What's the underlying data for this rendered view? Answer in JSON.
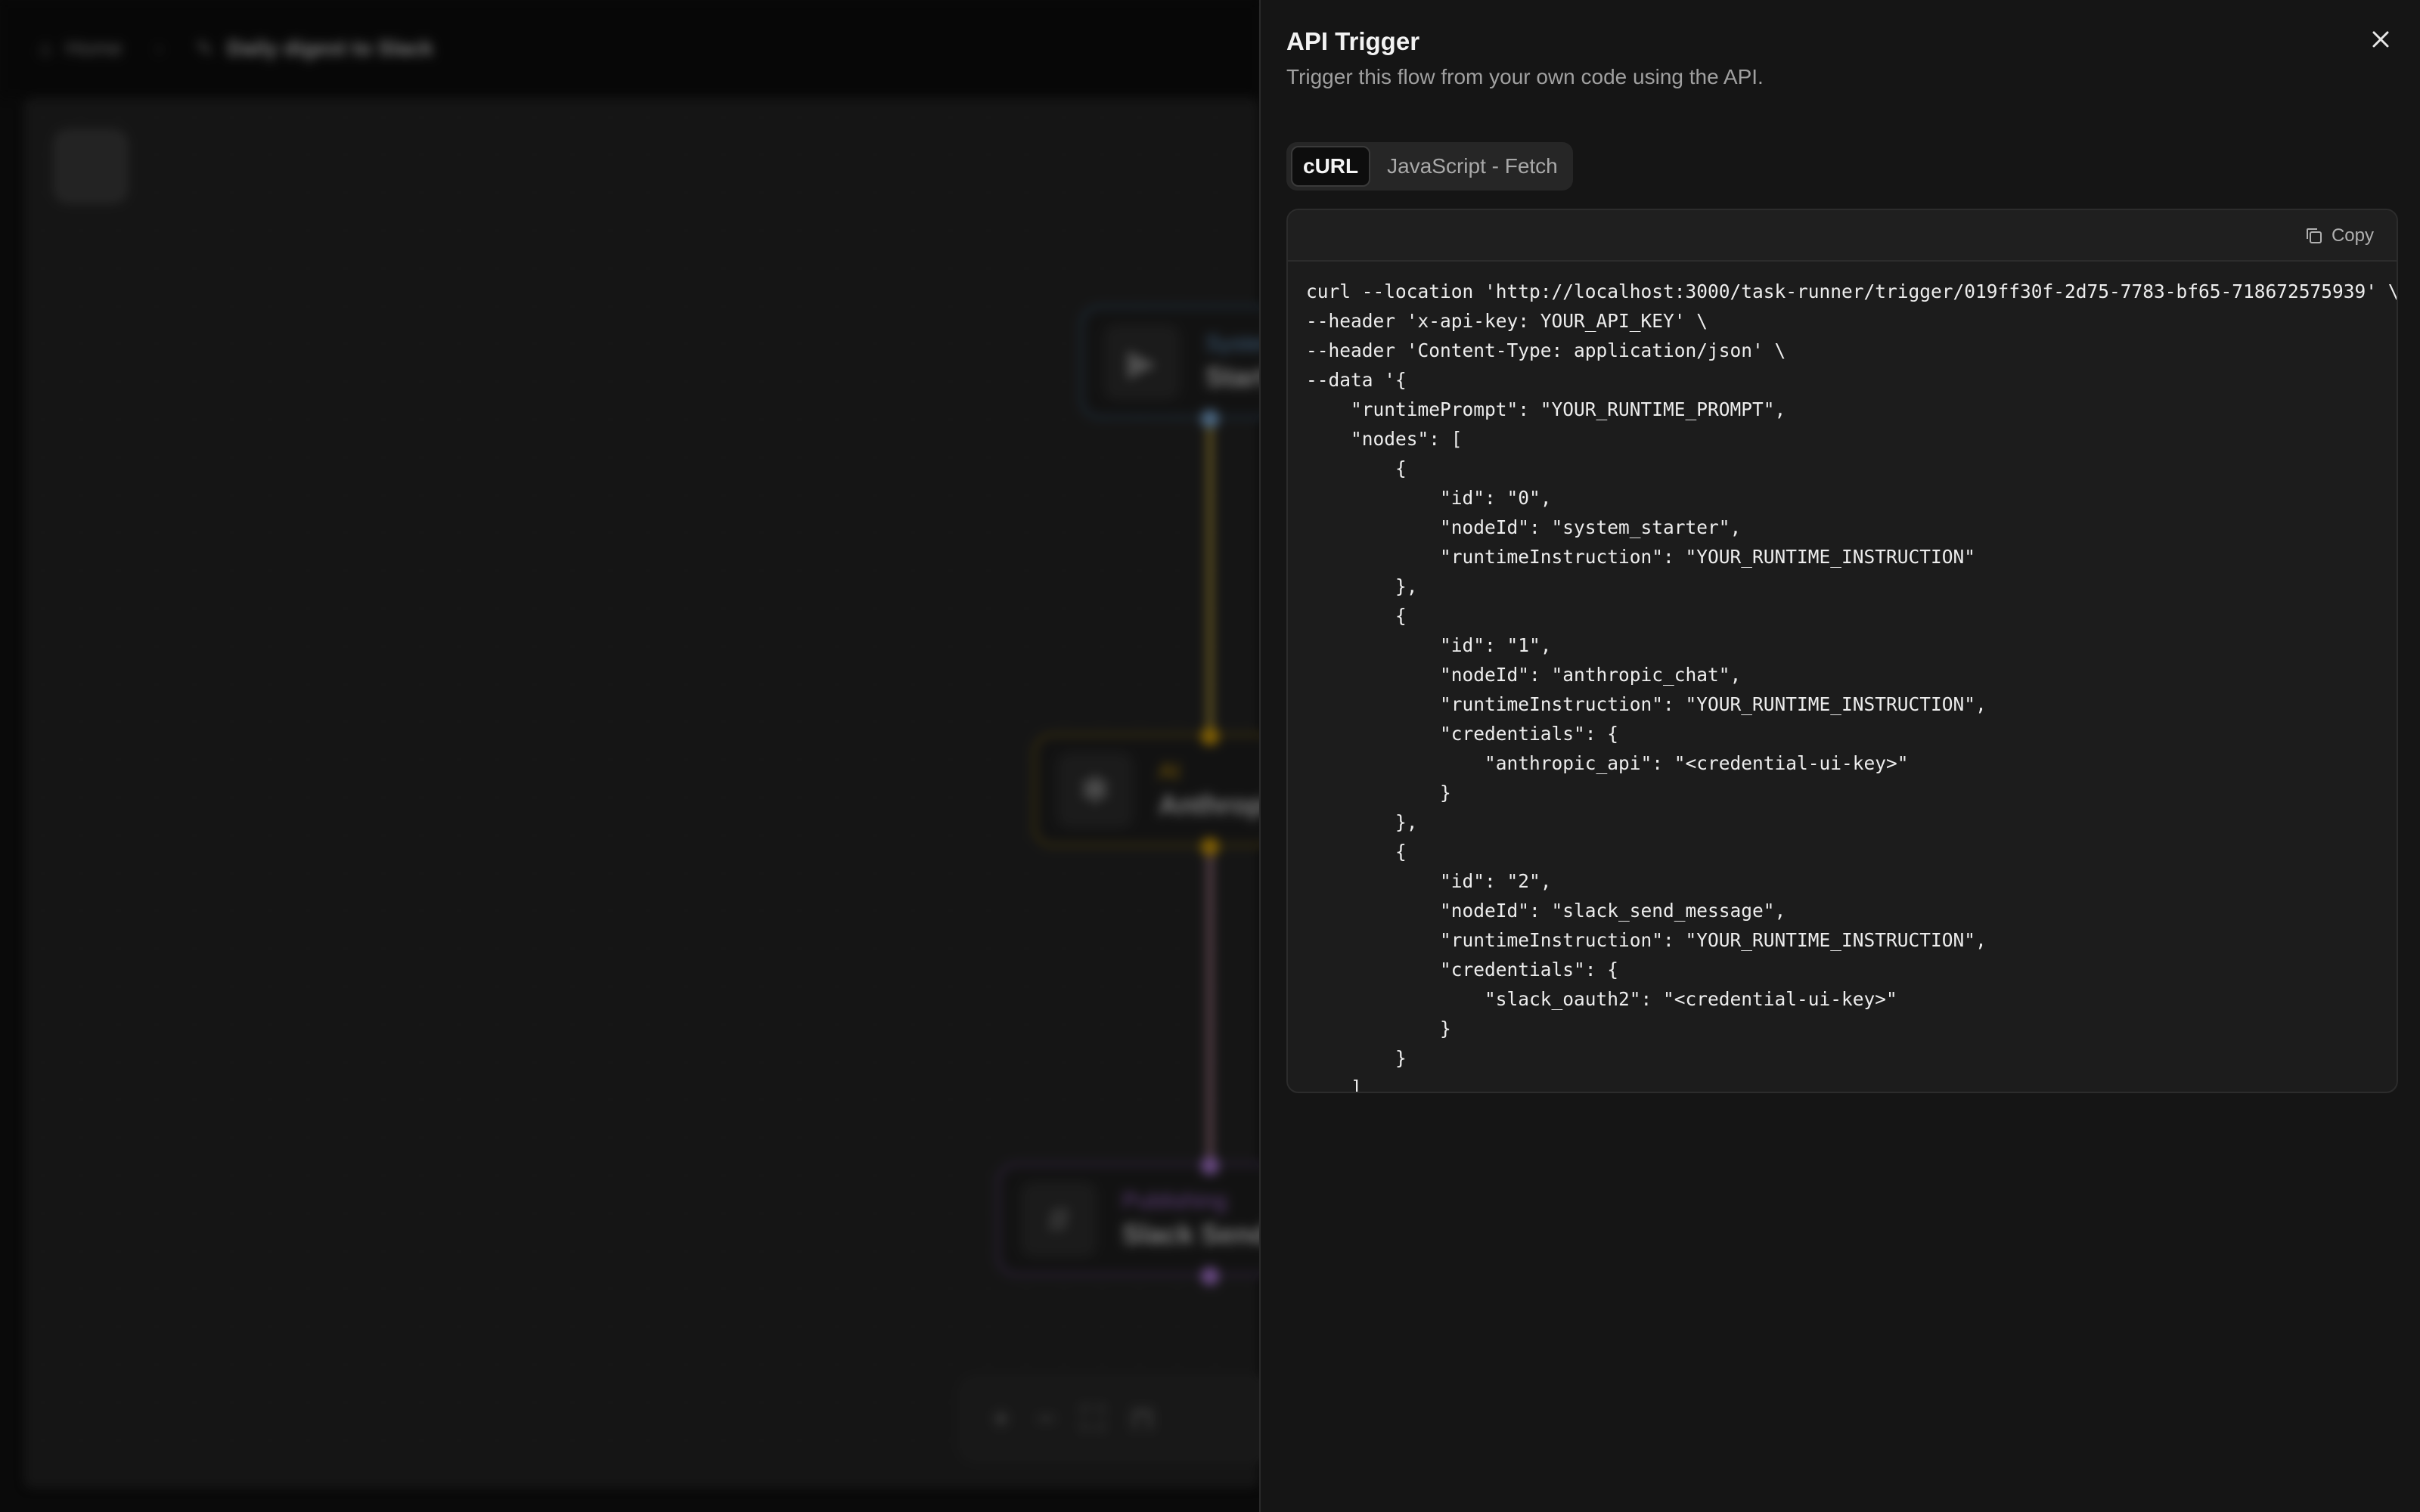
{
  "background": {
    "breadcrumb": {
      "home": "Home",
      "flow_name": "Daily digest to Slack"
    },
    "nodes": [
      {
        "category": "System",
        "name": "Start"
      },
      {
        "category": "AI",
        "name": "Anthropic"
      },
      {
        "category": "Publishing",
        "name": "Slack Send"
      }
    ]
  },
  "drawer": {
    "title": "API Trigger",
    "subtitle": "Trigger this flow from your own code using the API.",
    "tabs": [
      {
        "label": "cURL",
        "active": true
      },
      {
        "label": "JavaScript - Fetch",
        "active": false
      }
    ],
    "copy_label": "Copy",
    "code": "curl --location 'http://localhost:3000/task-runner/trigger/019ff30f-2d75-7783-bf65-718672575939' \\\n--header 'x-api-key: YOUR_API_KEY' \\\n--header 'Content-Type: application/json' \\\n--data '{\n    \"runtimePrompt\": \"YOUR_RUNTIME_PROMPT\",\n    \"nodes\": [\n        {\n            \"id\": \"0\",\n            \"nodeId\": \"system_starter\",\n            \"runtimeInstruction\": \"YOUR_RUNTIME_INSTRUCTION\"\n        },\n        {\n            \"id\": \"1\",\n            \"nodeId\": \"anthropic_chat\",\n            \"runtimeInstruction\": \"YOUR_RUNTIME_INSTRUCTION\",\n            \"credentials\": {\n                \"anthropic_api\": \"<credential-ui-key>\"\n            }\n        },\n        {\n            \"id\": \"2\",\n            \"nodeId\": \"slack_send_message\",\n            \"runtimeInstruction\": \"YOUR_RUNTIME_INSTRUCTION\",\n            \"credentials\": {\n                \"slack_oauth2\": \"<credential-ui-key>\"\n            }\n        }\n    ]"
  }
}
